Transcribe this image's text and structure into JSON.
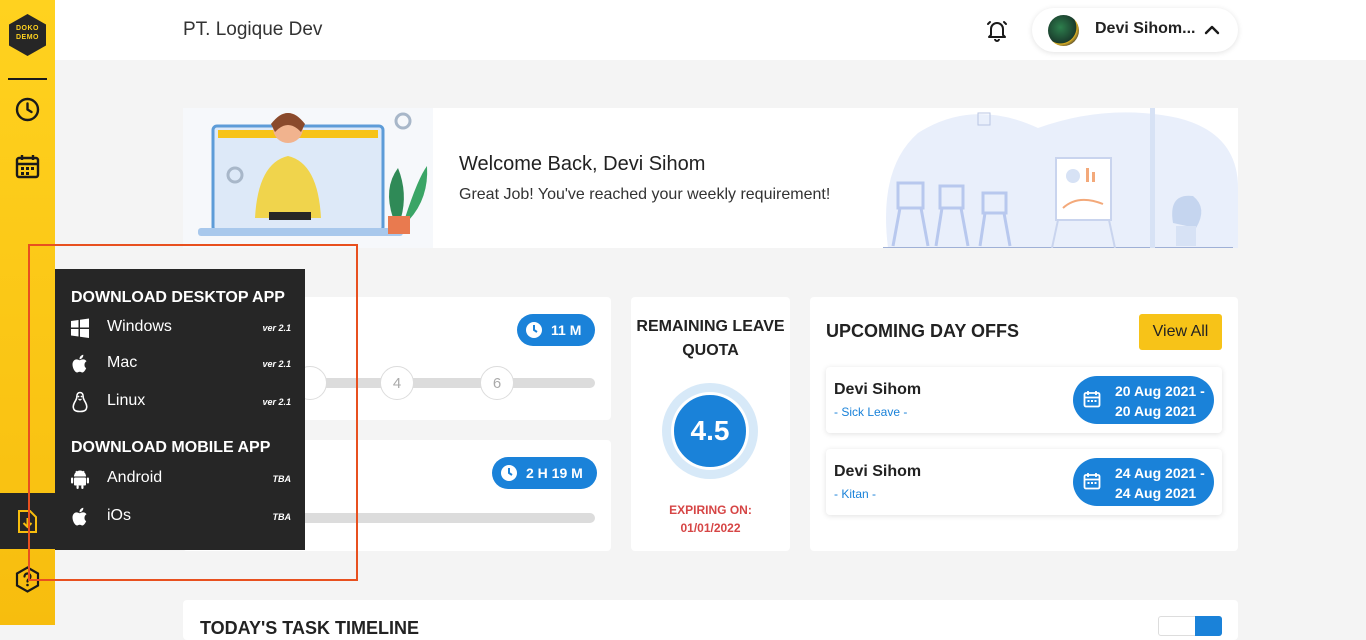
{
  "app": {
    "logo_text_top": "DOKO",
    "logo_text_bottom": "DEMO",
    "company": "PT. Logique Dev",
    "user_name": "Devi Sihom..."
  },
  "sidebar": {
    "items": [
      {
        "name": "history",
        "icon": "clock-icon"
      },
      {
        "name": "calendar",
        "icon": "calendar-icon"
      },
      {
        "name": "download",
        "icon": "download-icon"
      },
      {
        "name": "help",
        "icon": "help-icon"
      }
    ]
  },
  "banner": {
    "title": "Welcome Back, Devi Sihom",
    "subtitle": "Great Job! You've reached your weekly requirement!"
  },
  "progress_cards": [
    {
      "badge": "11 M",
      "steps": [
        "4",
        "6"
      ]
    },
    {
      "badge": "2 H 19 M"
    }
  ],
  "quota": {
    "title": "REMAINING LEAVE QUOTA",
    "value": "4.5",
    "expiring_label": "EXPIRING ON:",
    "expiring_date": "01/01/2022"
  },
  "dayoffs": {
    "title": "UPCOMING DAY OFFS",
    "view_all": "View All",
    "items": [
      {
        "name": "Devi Sihom",
        "type": "- Sick Leave -",
        "from": "20 Aug 2021 -",
        "to": "20 Aug 2021"
      },
      {
        "name": "Devi Sihom",
        "type": "- Kitan -",
        "from": "24 Aug 2021 -",
        "to": "24 Aug 2021"
      }
    ]
  },
  "timeline": {
    "title": "TODAY'S TASK TIMELINE"
  },
  "download_menu": {
    "desktop_heading": "DOWNLOAD DESKTOP APP",
    "mobile_heading": "DOWNLOAD MOBILE APP",
    "desktop": [
      {
        "label": "Windows",
        "version": "ver 2.1",
        "icon": "windows-icon"
      },
      {
        "label": "Mac",
        "version": "ver 2.1",
        "icon": "apple-icon"
      },
      {
        "label": "Linux",
        "version": "ver 2.1",
        "icon": "linux-icon"
      }
    ],
    "mobile": [
      {
        "label": "Android",
        "version": "TBA",
        "icon": "android-icon"
      },
      {
        "label": "iOs",
        "version": "TBA",
        "icon": "apple-icon"
      }
    ]
  },
  "colors": {
    "sidebar": "#ffd21f",
    "primary_blue": "#1a82d9",
    "accent_yellow": "#f7c318",
    "menu_bg": "#262626",
    "highlight": "#e8501f",
    "expiring": "#d64545"
  }
}
